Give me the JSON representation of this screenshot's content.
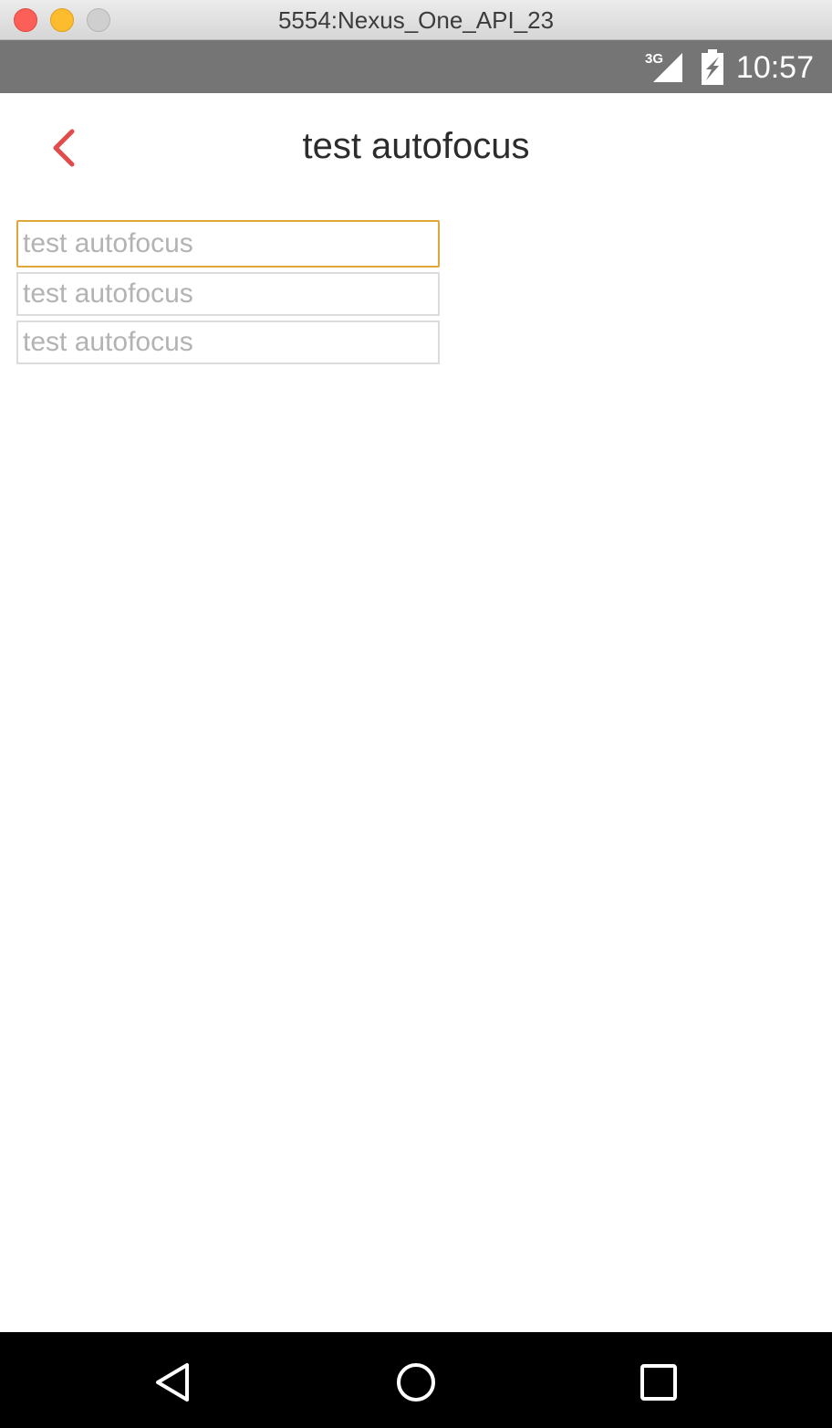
{
  "window": {
    "title": "5554:Nexus_One_API_23"
  },
  "status_bar": {
    "network": "3G",
    "time": "10:57"
  },
  "header": {
    "title": "test autofocus",
    "back_icon": "chevron-left-icon",
    "accent_color": "#e14b4b"
  },
  "inputs": [
    {
      "placeholder": "test autofocus",
      "value": "",
      "focused": true
    },
    {
      "placeholder": "test autofocus",
      "value": "",
      "focused": false
    },
    {
      "placeholder": "test autofocus",
      "value": "",
      "focused": false
    }
  ],
  "colors": {
    "focus_border": "#e0a83a",
    "input_border": "#dcdcdc",
    "status_bar": "#757575",
    "nav_bar": "#000000"
  },
  "nav_bar": {
    "icons": [
      "back-triangle-icon",
      "home-circle-icon",
      "recents-square-icon"
    ]
  }
}
